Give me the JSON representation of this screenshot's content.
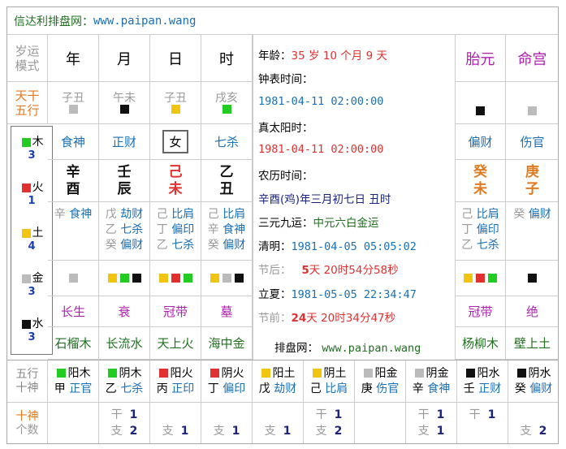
{
  "site": {
    "name": "信达利排盘网：",
    "url": "www.paipan.wang"
  },
  "header": {
    "corner_line1": "岁运",
    "corner_line2": "模式",
    "columns": [
      "年",
      "月",
      "日",
      "时"
    ],
    "right_columns": [
      "胎元",
      "命宫"
    ]
  },
  "row_labels": {
    "stem_branch_1": "天干",
    "stem_branch_2": "五行",
    "bottom_1a": "五行",
    "bottom_1b": "十神",
    "bottom_2a": "十神",
    "bottom_2b": "个数"
  },
  "hidden_pairs": [
    "子丑",
    "午未",
    "子丑",
    "戌亥"
  ],
  "pillars": [
    {
      "stem": "辛",
      "branch": "酉",
      "ten_god": "食神",
      "color": "#111111",
      "hidden": [
        {
          "stem": "辛",
          "god": "食神"
        }
      ],
      "nayin": "石榴木",
      "stage": "长生",
      "squares": [
        "#bbbbbb"
      ]
    },
    {
      "stem": "壬",
      "branch": "辰",
      "ten_god": "正财",
      "color": "#111111",
      "hidden": [
        {
          "stem": "戊",
          "god": "劫财"
        },
        {
          "stem": "乙",
          "god": "七杀"
        },
        {
          "stem": "癸",
          "god": "偏财"
        }
      ],
      "nayin": "长流水",
      "stage": "衰",
      "squares": [
        "#f1c40f",
        "#22cc22",
        "#111111"
      ]
    },
    {
      "stem": "己",
      "branch": "未",
      "ten_god": "女",
      "color": "#e03030",
      "hidden": [
        {
          "stem": "己",
          "god": "比肩"
        },
        {
          "stem": "丁",
          "god": "偏印"
        },
        {
          "stem": "乙",
          "god": "七杀"
        }
      ],
      "nayin": "天上火",
      "stage": "冠带",
      "squares": [
        "#f1c40f",
        "#e03030",
        "#22cc22"
      ]
    },
    {
      "stem": "乙",
      "branch": "丑",
      "ten_god": "七杀",
      "color": "#111111",
      "hidden": [
        {
          "stem": "己",
          "god": "比肩"
        },
        {
          "stem": "辛",
          "god": "食神"
        },
        {
          "stem": "癸",
          "god": "偏财"
        }
      ],
      "nayin": "海中金",
      "stage": "墓",
      "squares": [
        "#f1c40f",
        "#bbbbbb",
        "#111111"
      ]
    }
  ],
  "top_squares": [
    "#bbbbbb",
    "#111111",
    "#f1c40f",
    "#22cc22"
  ],
  "extra_pillars": [
    {
      "stem": "癸",
      "branch": "未",
      "ten_god": "偏财",
      "hidden": [
        {
          "stem": "己",
          "god": "比肩"
        },
        {
          "stem": "丁",
          "god": "偏印"
        },
        {
          "stem": "乙",
          "god": "七杀"
        }
      ],
      "nayin": "杨柳木",
      "stage": "冠带",
      "top_square": "#111111",
      "squares": [
        "#f1c40f",
        "#e03030",
        "#22cc22"
      ]
    },
    {
      "stem": "庚",
      "branch": "子",
      "ten_god": "伤官",
      "hidden": [
        {
          "stem": "癸",
          "god": "偏财"
        }
      ],
      "nayin": "壁上土",
      "stage": "绝",
      "top_square": "#bbbbbb",
      "squares": [
        "#111111"
      ]
    }
  ],
  "elements": [
    {
      "name": "木",
      "count": "3",
      "color": "#22cc22"
    },
    {
      "name": "火",
      "count": "1",
      "color": "#e03030"
    },
    {
      "name": "土",
      "count": "4",
      "color": "#f1c40f"
    },
    {
      "name": "金",
      "count": "3",
      "color": "#bbbbbb"
    },
    {
      "name": "水",
      "count": "3",
      "color": "#111111"
    }
  ],
  "info": {
    "age_label": "年龄：",
    "age_years": "35",
    "age_unit_y": "岁",
    "age_months": "10",
    "age_unit_m": "个月",
    "age_days": "9",
    "age_unit_d": "天",
    "clock_label": "钟表时间：",
    "clock_value": "1981-04-11 02:00:00",
    "solar_label": "真太阳时：",
    "solar_value": "1981-04-11 02:00:00",
    "lunar_label": "农历时间：",
    "lunar_value": "辛酉(鸡)年三月初七日 丑时",
    "sanyuan_label": "三元九运：",
    "sanyuan_value": "中元六白金运",
    "qingming_label": "清明：",
    "qingming_value": "1981-04-05 05:05:02",
    "after_label": "节后：",
    "after_days": "5",
    "after_d": "天",
    "after_h": "20",
    "after_hu": "时",
    "after_m": "54",
    "after_mu": "分",
    "after_s": "58",
    "after_su": "秒",
    "lixia_label": "立夏：",
    "lixia_value": "1981-05-05 22:34:47",
    "before_label": "节前：",
    "before_days": "24",
    "before_d": "天",
    "before_h": "20",
    "before_hu": "时",
    "before_m": "34",
    "before_mu": "分",
    "before_s": "47",
    "before_su": "秒",
    "site_label": "排盘网：",
    "site_url": "www.paipan.wang"
  },
  "ten_gods_grid": [
    {
      "element_color": "#22cc22",
      "yy": "阳木",
      "stem": "甲",
      "god": "正官"
    },
    {
      "element_color": "#22cc22",
      "yy": "阴木",
      "stem": "乙",
      "god": "七杀"
    },
    {
      "element_color": "#e03030",
      "yy": "阳火",
      "stem": "丙",
      "god": "正印"
    },
    {
      "element_color": "#e03030",
      "yy": "阴火",
      "stem": "丁",
      "god": "偏印"
    },
    {
      "element_color": "#f1c40f",
      "yy": "阳土",
      "stem": "戊",
      "god": "劫财"
    },
    {
      "element_color": "#f1c40f",
      "yy": "阴土",
      "stem": "己",
      "god": "比肩"
    },
    {
      "element_color": "#bbbbbb",
      "yy": "阳金",
      "stem": "庚",
      "god": "伤官"
    },
    {
      "element_color": "#bbbbbb",
      "yy": "阴金",
      "stem": "辛",
      "god": "食神"
    },
    {
      "element_color": "#111111",
      "yy": "阳水",
      "stem": "壬",
      "god": "正财"
    },
    {
      "element_color": "#111111",
      "yy": "阴水",
      "stem": "癸",
      "god": "偏财"
    }
  ],
  "counts_grid": [
    {
      "gan": "",
      "gan_n": "",
      "zhi": "",
      "zhi_n": ""
    },
    {
      "gan": "干",
      "gan_n": "1",
      "zhi": "支",
      "zhi_n": "2"
    },
    {
      "gan": "",
      "gan_n": "",
      "zhi": "支",
      "zhi_n": "1"
    },
    {
      "gan": "",
      "gan_n": "",
      "zhi": "支",
      "zhi_n": "1"
    },
    {
      "gan": "",
      "gan_n": "",
      "zhi": "支",
      "zhi_n": "1"
    },
    {
      "gan": "干",
      "gan_n": "1",
      "zhi": "支",
      "zhi_n": "2"
    },
    {
      "gan": "",
      "gan_n": "",
      "zhi": "",
      "zhi_n": ""
    },
    {
      "gan": "干",
      "gan_n": "1",
      "zhi": "支",
      "zhi_n": "1"
    },
    {
      "gan": "干",
      "gan_n": "1",
      "zhi": "",
      "zhi_n": ""
    },
    {
      "gan": "",
      "gan_n": "",
      "zhi": "支",
      "zhi_n": "2"
    }
  ]
}
